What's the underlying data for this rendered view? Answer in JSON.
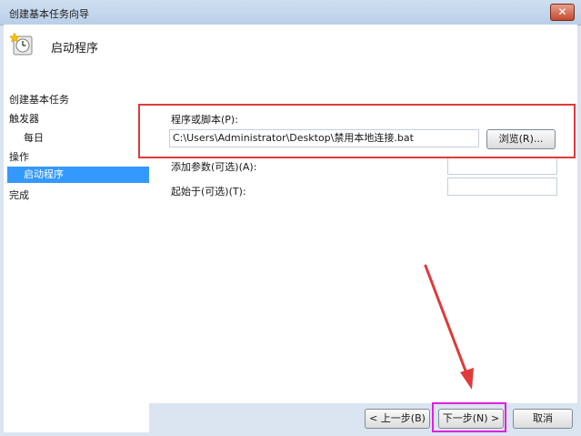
{
  "window": {
    "title": "创建基本任务向导",
    "close_glyph": "✕"
  },
  "header": {
    "title": "启动程序",
    "icon": "clock-icon"
  },
  "sidebar": {
    "items": [
      {
        "label": "创建基本任务",
        "level": 0,
        "active": false
      },
      {
        "label": "触发器",
        "level": 0,
        "active": false
      },
      {
        "label": "每日",
        "level": 1,
        "active": false
      },
      {
        "label": "操作",
        "level": 0,
        "active": false
      },
      {
        "label": "启动程序",
        "level": 1,
        "active": true
      },
      {
        "label": "完成",
        "level": 0,
        "active": false
      }
    ]
  },
  "form": {
    "program_label": "程序或脚本(P):",
    "program_value": "C:\\Users\\Administrator\\Desktop\\禁用本地连接.bat",
    "browse_label": "浏览(R)...",
    "args_label": "添加参数(可选)(A):",
    "args_value": "",
    "start_label": "起始于(可选)(T):",
    "start_value": ""
  },
  "footer": {
    "back_label": "< 上一步(B)",
    "next_label": "下一步(N) >",
    "cancel_label": "取消"
  },
  "colors": {
    "highlight_red": "#e03a3a",
    "highlight_magenta": "#e21ee2",
    "selection": "#3399ff"
  }
}
